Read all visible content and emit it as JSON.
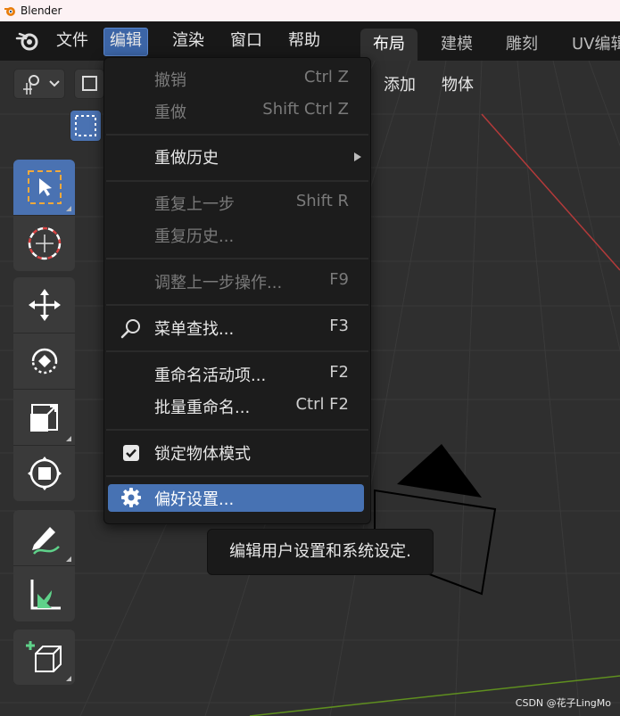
{
  "window": {
    "title": "Blender"
  },
  "topbar": {
    "menus": [
      {
        "label": "文件"
      },
      {
        "label": "编辑"
      },
      {
        "label": "渲染"
      },
      {
        "label": "窗口"
      },
      {
        "label": "帮助"
      }
    ],
    "workspace_tabs": [
      {
        "label": "布局"
      },
      {
        "label": "建模"
      },
      {
        "label": "雕刻"
      },
      {
        "label": "UV编辑"
      }
    ]
  },
  "viewport": {
    "header_menus": [
      {
        "label": "添加"
      },
      {
        "label": "物体"
      }
    ]
  },
  "toolbar": {
    "tools": [
      {
        "icon": "select-box-icon",
        "active": true
      },
      {
        "icon": "cursor-icon"
      },
      {
        "icon": "move-icon"
      },
      {
        "icon": "rotate-icon"
      },
      {
        "icon": "scale-icon"
      },
      {
        "icon": "transform-icon"
      },
      {
        "icon": "annotate-icon"
      },
      {
        "icon": "measure-icon"
      },
      {
        "icon": "add-cube-icon"
      }
    ]
  },
  "edit_menu": {
    "items": [
      {
        "label": "撤销",
        "shortcut": "Ctrl Z",
        "enabled": false
      },
      {
        "label": "重做",
        "shortcut": "Shift Ctrl Z",
        "enabled": false
      },
      {
        "label": "重做历史",
        "shortcut": "",
        "enabled": true,
        "submenu": true
      },
      {
        "label": "重复上一步",
        "shortcut": "Shift R",
        "enabled": false
      },
      {
        "label": "重复历史...",
        "shortcut": "",
        "enabled": false
      },
      {
        "label": "调整上一步操作...",
        "shortcut": "F9",
        "enabled": false
      },
      {
        "label": "菜单查找...",
        "shortcut": "F3",
        "enabled": true,
        "icon": "search-icon"
      },
      {
        "label": "重命名活动项...",
        "shortcut": "F2",
        "enabled": true
      },
      {
        "label": "批量重命名...",
        "shortcut": "Ctrl F2",
        "enabled": true
      },
      {
        "label": "锁定物体模式",
        "shortcut": "",
        "enabled": true,
        "icon": "checkbox-checked-icon",
        "checked": true
      },
      {
        "label": "偏好设置...",
        "shortcut": "",
        "enabled": true,
        "icon": "gear-icon",
        "highlighted": true
      }
    ]
  },
  "tooltip": {
    "text": "编辑用户设置和系统设定."
  },
  "watermark": {
    "text": "CSDN @花子LingMo"
  },
  "colors": {
    "accent": "#4772b3",
    "menu_bg": "#1c1c1c",
    "viewport_bg": "#2f2f2f",
    "x_axis": "#b33a3a",
    "y_axis": "#5f8f1f"
  }
}
